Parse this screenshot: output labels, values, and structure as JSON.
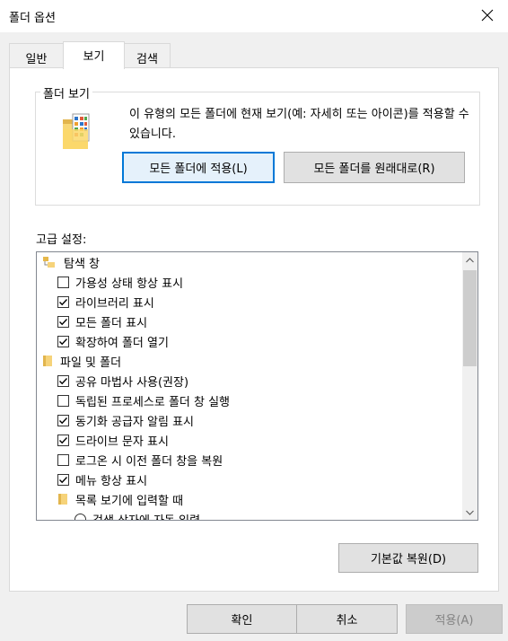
{
  "window": {
    "title": "폴더 옵션"
  },
  "tabs": [
    {
      "label": "일반"
    },
    {
      "label": "보기"
    },
    {
      "label": "검색"
    }
  ],
  "folder_views": {
    "legend": "폴더 보기",
    "description": "이 유형의 모든 폴더에 현재 보기(예: 자세히 또는 아이콘)를 적용할 수 있습니다.",
    "apply_button": "모든 폴더에 적용(L)",
    "reset_button": "모든 폴더를 원래대로(R)"
  },
  "advanced": {
    "label": "고급 설정:",
    "items": [
      {
        "label": "탐색 창",
        "type": "folder"
      },
      {
        "label": "가용성 상태 항상 표시",
        "type": "checkbox",
        "checked": false
      },
      {
        "label": "라이브러리 표시",
        "type": "checkbox",
        "checked": true
      },
      {
        "label": "모든 폴더 표시",
        "type": "checkbox",
        "checked": true
      },
      {
        "label": "확장하여 폴더 열기",
        "type": "checkbox",
        "checked": true
      },
      {
        "label": "파일 및 폴더",
        "type": "folder"
      },
      {
        "label": "공유 마법사 사용(권장)",
        "type": "checkbox",
        "checked": true
      },
      {
        "label": "독립된 프로세스로 폴더 창 실행",
        "type": "checkbox",
        "checked": false
      },
      {
        "label": "동기화 공급자 알림 표시",
        "type": "checkbox",
        "checked": true
      },
      {
        "label": "드라이브 문자 표시",
        "type": "checkbox",
        "checked": true
      },
      {
        "label": "로그온 시 이전 폴더 창을 복원",
        "type": "checkbox",
        "checked": false
      },
      {
        "label": "메뉴 항상 표시",
        "type": "checkbox",
        "checked": true
      },
      {
        "label": "목록 보기에 입력할 때",
        "type": "subfolder"
      },
      {
        "label": "검색 상자에 자동 입력",
        "type": "radio",
        "checked": false
      }
    ],
    "restore_defaults_button": "기본값 복원(D)"
  },
  "footer": {
    "ok_button": "확인",
    "cancel_button": "취소",
    "apply_button": "적용(A)"
  }
}
